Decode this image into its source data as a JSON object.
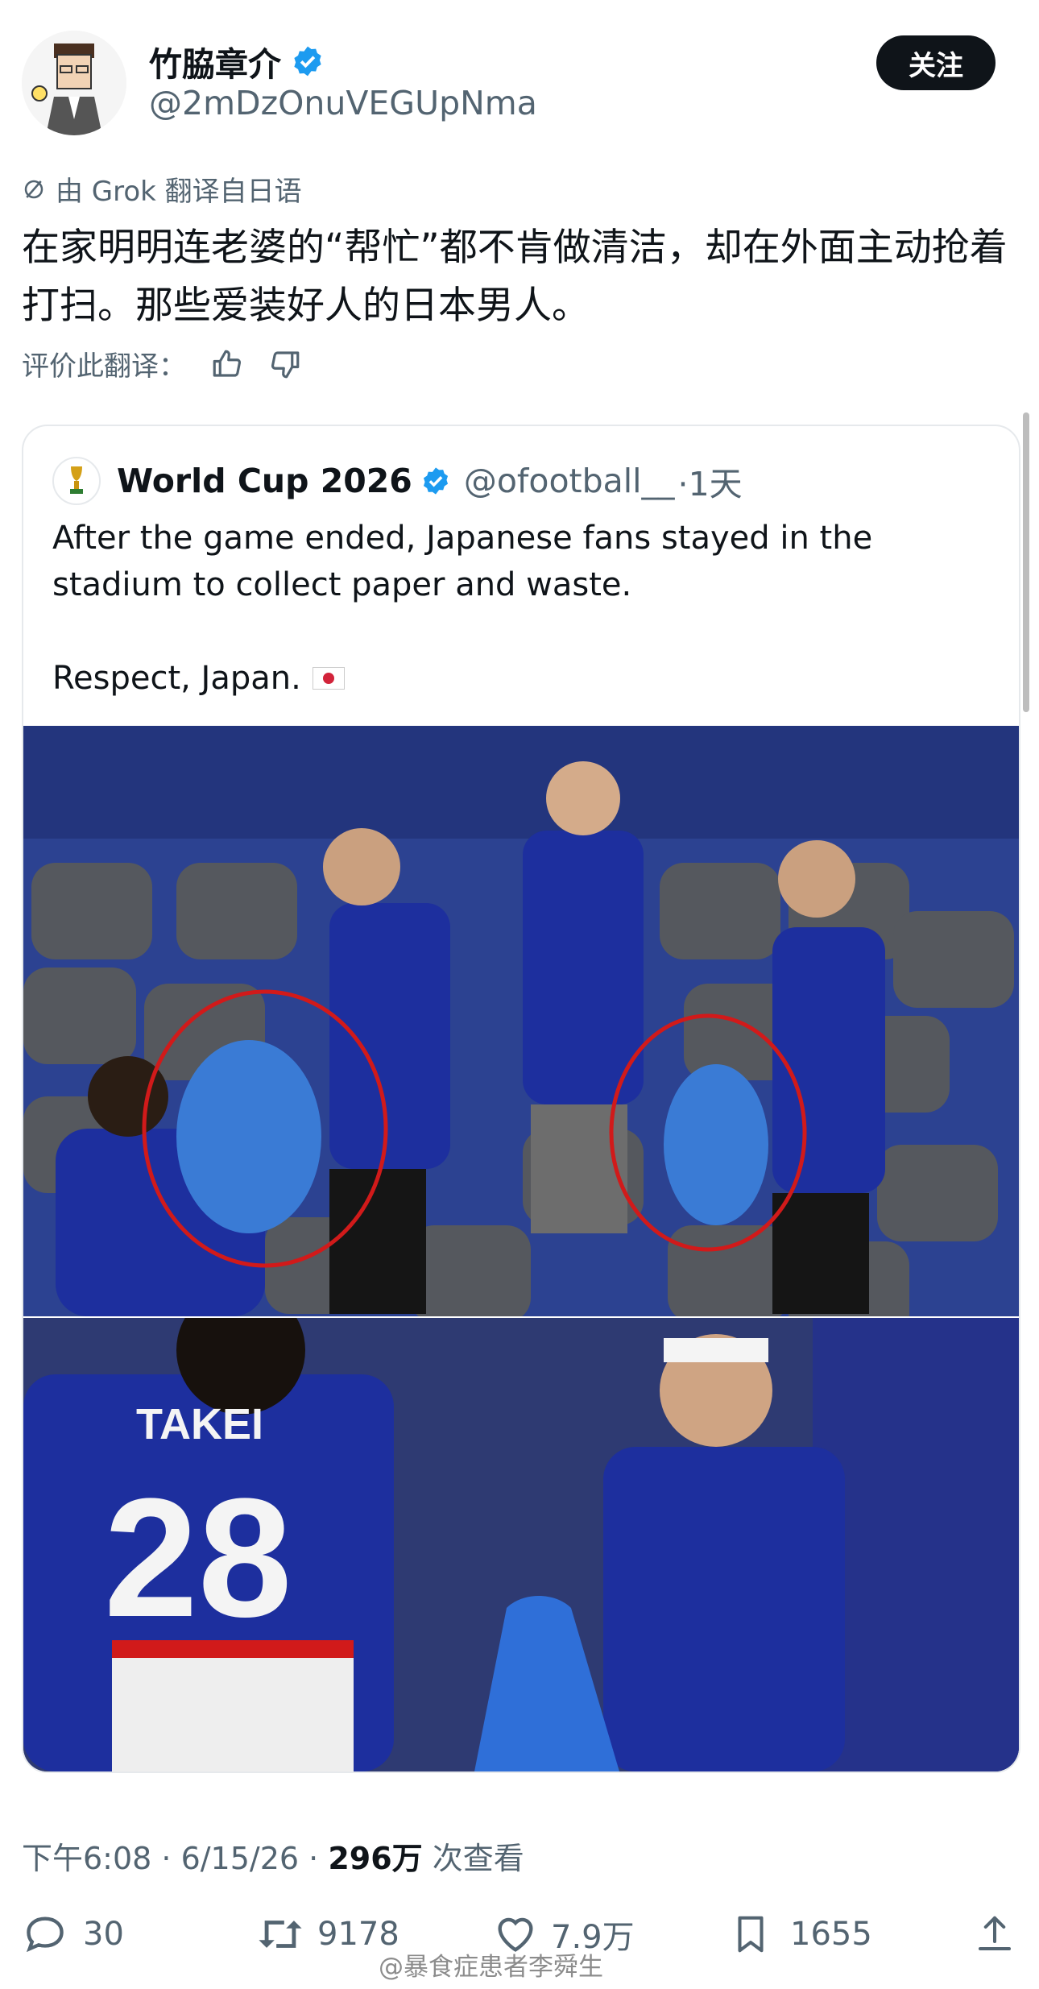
{
  "author": {
    "name": "竹脇章介",
    "handle": "@2mDzOnuVEGUpNma",
    "follow_label": "关注"
  },
  "translation": {
    "note": "由 Grok 翻译自日语",
    "body": "在家明明连老婆的“帮忙”都不肯做清洁，却在外面主动抢着打扫。那些爱装好人的日本男人。",
    "rate_label": "评价此翻译："
  },
  "quote": {
    "name": "World Cup 2026",
    "handle": "@ofootball__",
    "time": "·1天",
    "text_line": "After the game ended, Japanese fans stayed in the stadium to collect paper and waste.",
    "text_p2": "Respect, Japan."
  },
  "post_meta": {
    "time": "下午6:08 · 6/15/26 · ",
    "views": "296万",
    "views_suffix": " 次查看"
  },
  "actions": {
    "replies": "30",
    "reposts": "9178",
    "likes": "7.9万",
    "bookmarks": "1655"
  },
  "watermark": "@暴食症患者李舜生",
  "photo_text": {
    "jersey_back_name": "TAKEI",
    "jersey_back_number": "28"
  },
  "colors": {
    "accent_verified": "#1d9bf0",
    "text_secondary": "#536471",
    "jersey_blue": "#1d2f9e",
    "bag_blue": "#3a7bd5",
    "circle_red": "#d11a1a"
  }
}
